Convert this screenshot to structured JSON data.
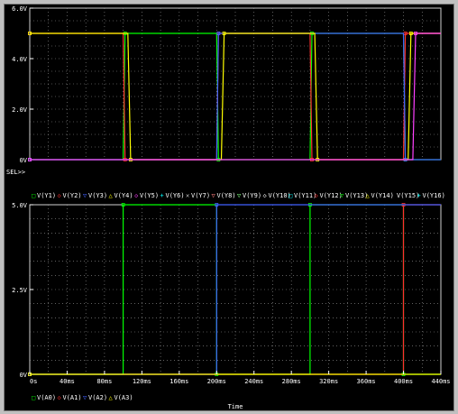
{
  "chart_data": [
    {
      "type": "line",
      "selection_marker": "SEL>>",
      "y_ticks": [
        "0V",
        "2.0V",
        "4.0V",
        "6.0V"
      ],
      "ylim": [
        0,
        6
      ],
      "xlim": [
        0,
        440
      ],
      "legend": [
        {
          "symbol": "□",
          "label": "V(Y1)",
          "color": "#00ff00"
        },
        {
          "symbol": "◇",
          "label": "V(Y2)",
          "color": "#ff3030"
        },
        {
          "symbol": "▽",
          "label": "V(Y3)",
          "color": "#4060ff"
        },
        {
          "symbol": "△",
          "label": "V(Y4)",
          "color": "#ffff00"
        },
        {
          "symbol": "◇",
          "label": "V(Y5)",
          "color": "#ff40ff"
        },
        {
          "symbol": "+",
          "label": "V(Y6)",
          "color": "#00ffff"
        },
        {
          "symbol": "✕",
          "label": "V(Y7)",
          "color": "#c0c0c0"
        },
        {
          "symbol": "▽",
          "label": "V(Y8)",
          "color": "#ff8080"
        },
        {
          "symbol": "▽",
          "label": "V(Y9)",
          "color": "#80ff80"
        },
        {
          "symbol": "◇",
          "label": "V(Y10)",
          "color": "#ffffff"
        },
        {
          "symbol": "□",
          "label": "V(Y11)",
          "color": "#00ffff"
        },
        {
          "symbol": "◇",
          "label": "V(Y12)",
          "color": "#ff3030"
        },
        {
          "symbol": "▽",
          "label": "V(Y13)",
          "color": "#00ff00"
        },
        {
          "symbol": "△",
          "label": "V(Y14)",
          "color": "#ffff00"
        },
        {
          "symbol": "",
          "label": "V(Y15)",
          "color": "#ff40ff"
        },
        {
          "symbol": "+",
          "label": "V(Y16)",
          "color": "#00ffff"
        }
      ],
      "traces": [
        {
          "label": "V(Y1)",
          "color": "#00ff00",
          "points": [
            [
              0,
              0
            ],
            [
              100,
              0
            ],
            [
              102,
              5
            ],
            [
              200,
              5
            ],
            [
              202,
              0
            ],
            [
              300,
              0
            ],
            [
              302,
              5
            ],
            [
              400,
              5
            ],
            [
              402,
              0
            ],
            [
              440,
              0
            ]
          ]
        },
        {
          "label": "V(Y2)",
          "color": "#ff3030",
          "points": [
            [
              0,
              5
            ],
            [
              100,
              5
            ],
            [
              102,
              0
            ],
            [
              200,
              0
            ],
            [
              202,
              5
            ],
            [
              300,
              5
            ],
            [
              302,
              0
            ],
            [
              400,
              0
            ],
            [
              402,
              5
            ],
            [
              440,
              5
            ]
          ]
        },
        {
          "label": "V(Y3)",
          "color": "#4060ff",
          "points": [
            [
              0,
              0
            ],
            [
              200,
              0
            ],
            [
              202,
              5
            ],
            [
              400,
              5
            ],
            [
              402,
              0
            ],
            [
              440,
              0
            ]
          ]
        },
        {
          "label": "V(Y4)",
          "color": "#ffff00",
          "points": [
            [
              0,
              5
            ],
            [
              105,
              5
            ],
            [
              108,
              0
            ],
            [
              205,
              0
            ],
            [
              208,
              5
            ],
            [
              305,
              5
            ],
            [
              308,
              0
            ],
            [
              405,
              0
            ],
            [
              408,
              5
            ],
            [
              440,
              5
            ]
          ]
        },
        {
          "label": "V(Y5)",
          "color": "#ff40ff",
          "points": [
            [
              0,
              0
            ],
            [
              410,
              0
            ],
            [
              413,
              5
            ],
            [
              440,
              5
            ]
          ]
        }
      ]
    },
    {
      "type": "line",
      "y_ticks": [
        "0V",
        "2.5V",
        "5.0V"
      ],
      "ylim": [
        0,
        5
      ],
      "xlim": [
        0,
        440
      ],
      "x_ticks": [
        "0s",
        "40ms",
        "80ms",
        "120ms",
        "160ms",
        "200ms",
        "240ms",
        "280ms",
        "320ms",
        "360ms",
        "400ms",
        "440ms"
      ],
      "xlabel": "Time",
      "legend": [
        {
          "symbol": "□",
          "label": "V(A0)",
          "color": "#00ff00"
        },
        {
          "symbol": "◇",
          "label": "V(A1)",
          "color": "#ff3030"
        },
        {
          "symbol": "▽",
          "label": "V(A2)",
          "color": "#4060ff"
        },
        {
          "symbol": "△",
          "label": "V(A3)",
          "color": "#ffff00"
        }
      ],
      "traces": [
        {
          "label": "V(A0)",
          "color": "#00ff00",
          "points": [
            [
              0,
              0
            ],
            [
              100,
              0
            ],
            [
              100,
              5
            ],
            [
              200,
              5
            ],
            [
              200,
              0
            ],
            [
              300,
              0
            ],
            [
              300,
              5
            ],
            [
              400,
              5
            ],
            [
              400,
              0
            ],
            [
              440,
              0
            ]
          ]
        },
        {
          "label": "V(A1)",
          "color": "#ff3030",
          "points": [
            [
              0,
              0
            ],
            [
              400,
              0
            ],
            [
              400,
              5
            ],
            [
              440,
              5
            ]
          ]
        },
        {
          "label": "V(A2)",
          "color": "#4060ff",
          "points": [
            [
              0,
              0
            ],
            [
              200,
              0
            ],
            [
              200,
              5
            ],
            [
              440,
              5
            ]
          ]
        },
        {
          "label": "V(A3)",
          "color": "#ffff00",
          "points": [
            [
              0,
              0
            ],
            [
              440,
              0
            ]
          ]
        }
      ]
    }
  ]
}
